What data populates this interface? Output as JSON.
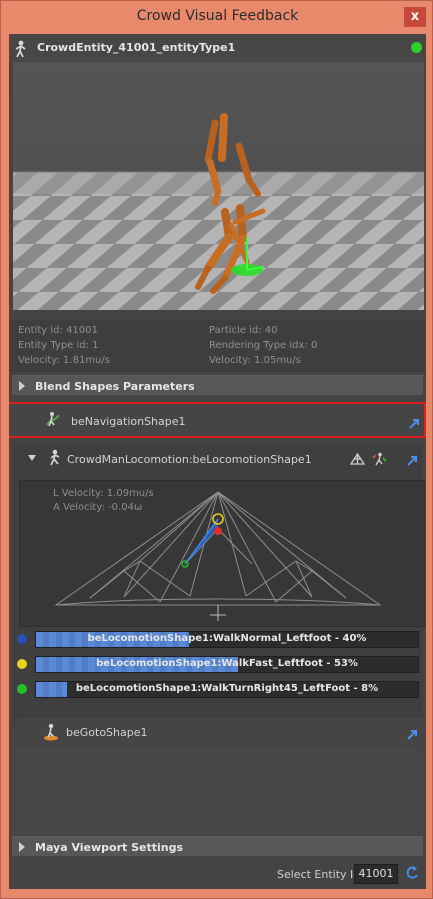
{
  "window": {
    "title": "Crowd Visual Feedback",
    "close_label": "x"
  },
  "entity": {
    "name": "CrowdEntity_41001_entityType1",
    "status_color": "#2ad22a"
  },
  "info": {
    "entity_id": "Entity id: 41001",
    "entity_type_id": "Entity Type id: 1",
    "velocity": "Velocity: 1.81mu/s",
    "particle_id": "Particle id: 40",
    "rendering_type_idx": "Rendering Type idx: 0",
    "velocity2": "Velocity: 1.05mu/s"
  },
  "sections": {
    "blend_shapes": "Blend Shapes Parameters",
    "maya_viewport": "Maya Viewport Settings"
  },
  "behaviors": {
    "navigation": "beNavigationShape1",
    "locomotion": "CrowdManLocomotion:beLocomotionShape1",
    "goto": "beGotoShape1"
  },
  "locomotion": {
    "l_velocity": "L Velocity: 1.09mu/s",
    "a_velocity": "A Velocity: -0.04ω",
    "clips": [
      {
        "label": "beLocomotionShape1:WalkNormal_Leftfoot - 40%",
        "weight": 0.4,
        "color": "#2a4fb8"
      },
      {
        "label": "beLocomotionShape1:WalkFast_Leftfoot - 53%",
        "weight": 0.53,
        "color": "#e7d21a"
      },
      {
        "label": "beLocomotionShape1:WalkTurnRight45_LeftFoot - 8%",
        "weight": 0.08,
        "color": "#22c022"
      }
    ]
  },
  "footer": {
    "select_label": "Select Entity Id",
    "entity_id_value": "41001"
  }
}
